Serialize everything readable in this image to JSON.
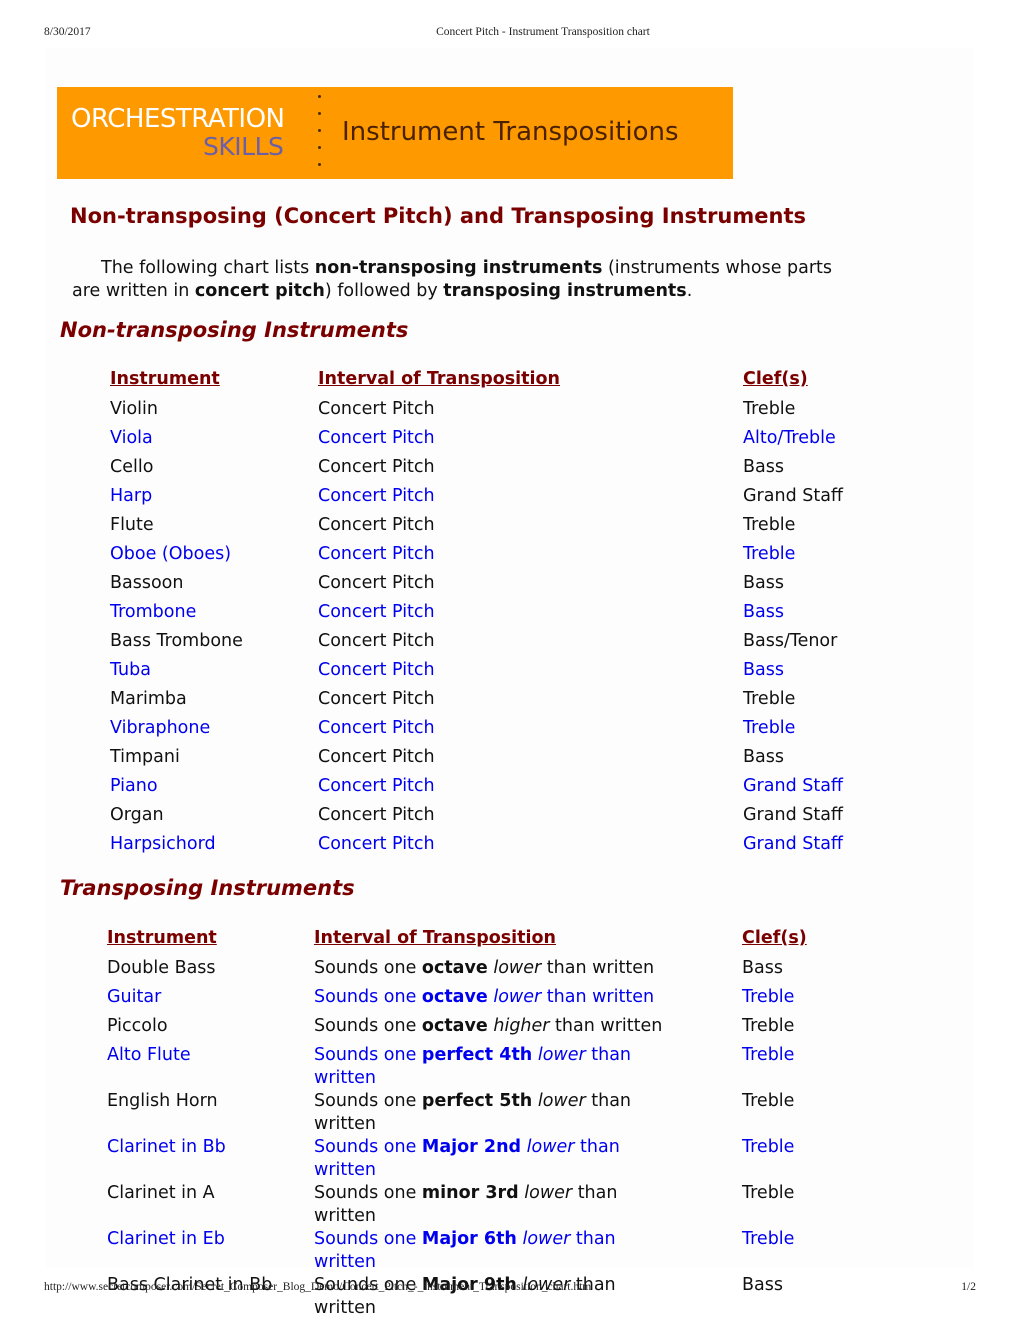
{
  "print_header": {
    "date": "8/30/2017",
    "title": "Concert Pitch - Instrument Transposition chart"
  },
  "print_footer": {
    "url": "http://www.secretcomposer.com/Secret_Composer_Blog_Demo/Concert_Pitch_-_Instrument_Transposition_chart.htm",
    "page": "1/2"
  },
  "banner": {
    "brand_line1": "ORCHESTRATION",
    "brand_line2": "SKILLS",
    "subtitle": "Instrument Transpositions",
    "background_color": "#ff9900"
  },
  "page_title": "Non-transposing (Concert Pitch) and Transposing Instruments",
  "intro": {
    "t1": "The following chart lists ",
    "b1": "non-transposing instruments",
    "t2": " (instruments whose parts are written in ",
    "b2": "concert pitch",
    "t3": ") followed by ",
    "b3": "transposing instruments",
    "t4": "."
  },
  "colors": {
    "heading": "#7a0000",
    "link_blue": "#0000ee",
    "text": "#111111"
  },
  "non_transposing": {
    "heading": "Non-transposing Instruments",
    "columns": [
      "Instrument",
      "Interval of Transposition",
      "Clef(s)"
    ],
    "rows": [
      {
        "instrument": "Violin",
        "interval": "Concert Pitch",
        "clef": "Treble",
        "inst_color": "black",
        "int_color": "black",
        "clef_color": "black"
      },
      {
        "instrument": "Viola",
        "interval": "Concert Pitch",
        "clef": "Alto/Treble",
        "inst_color": "blue",
        "int_color": "blue",
        "clef_color": "blue"
      },
      {
        "instrument": "Cello",
        "interval": "Concert Pitch",
        "clef": "Bass",
        "inst_color": "black",
        "int_color": "black",
        "clef_color": "black"
      },
      {
        "instrument": "Harp",
        "interval": "Concert Pitch",
        "clef": "Grand Staff",
        "inst_color": "blue",
        "int_color": "blue",
        "clef_color": "black"
      },
      {
        "instrument": "Flute",
        "interval": "Concert Pitch",
        "clef": "Treble",
        "inst_color": "black",
        "int_color": "black",
        "clef_color": "black"
      },
      {
        "instrument": "Oboe (Oboes)",
        "interval": "Concert Pitch",
        "clef": "Treble",
        "inst_color": "blue",
        "int_color": "blue",
        "clef_color": "blue"
      },
      {
        "instrument": "Bassoon",
        "interval": "Concert Pitch",
        "clef": "Bass",
        "inst_color": "black",
        "int_color": "black",
        "clef_color": "black"
      },
      {
        "instrument": "Trombone",
        "interval": "Concert Pitch",
        "clef": "Bass",
        "inst_color": "blue",
        "int_color": "blue",
        "clef_color": "blue"
      },
      {
        "instrument": "Bass Trombone",
        "interval": "Concert Pitch",
        "clef": "Bass/Tenor",
        "inst_color": "black",
        "int_color": "black",
        "clef_color": "black"
      },
      {
        "instrument": "Tuba",
        "interval": "Concert Pitch",
        "clef": "Bass",
        "inst_color": "blue",
        "int_color": "blue",
        "clef_color": "blue"
      },
      {
        "instrument": "Marimba",
        "interval": "Concert Pitch",
        "clef": "Treble",
        "inst_color": "black",
        "int_color": "black",
        "clef_color": "black"
      },
      {
        "instrument": "Vibraphone",
        "interval": "Concert Pitch",
        "clef": "Treble",
        "inst_color": "blue",
        "int_color": "blue",
        "clef_color": "blue"
      },
      {
        "instrument": "Timpani",
        "interval": "Concert Pitch",
        "clef": "Bass",
        "inst_color": "black",
        "int_color": "black",
        "clef_color": "black"
      },
      {
        "instrument": "Piano",
        "interval": "Concert Pitch",
        "clef": "Grand Staff",
        "inst_color": "blue",
        "int_color": "blue",
        "clef_color": "blue"
      },
      {
        "instrument": "Organ",
        "interval": "Concert Pitch",
        "clef": "Grand Staff",
        "inst_color": "black",
        "int_color": "black",
        "clef_color": "black"
      },
      {
        "instrument": "Harpsichord",
        "interval": "Concert Pitch",
        "clef": "Grand Staff",
        "inst_color": "blue",
        "int_color": "blue",
        "clef_color": "blue"
      }
    ]
  },
  "transposing": {
    "heading": "Transposing Instruments",
    "columns": [
      "Instrument",
      "Interval of Transposition",
      "Clef(s)"
    ],
    "rows": [
      {
        "instrument": "Double Bass",
        "pre": "Sounds one ",
        "interval_bold": "octave",
        "direction": "lower",
        "post": " than written",
        "clef": "Bass",
        "color": "black"
      },
      {
        "instrument": "Guitar",
        "pre": "Sounds one ",
        "interval_bold": "octave",
        "direction": "lower",
        "post": " than written",
        "clef": "Treble",
        "color": "blue"
      },
      {
        "instrument": "Piccolo",
        "pre": "Sounds one ",
        "interval_bold": "octave",
        "direction": "higher",
        "post": " than written",
        "clef": "Treble",
        "color": "black"
      },
      {
        "instrument": "Alto Flute",
        "pre": "Sounds one ",
        "interval_bold": "perfect 4th",
        "direction": "lower",
        "post": " than written",
        "clef": "Treble",
        "color": "blue"
      },
      {
        "instrument": "English Horn",
        "pre": "Sounds one ",
        "interval_bold": "perfect 5th",
        "direction": "lower",
        "post": " than written",
        "clef": "Treble",
        "color": "black"
      },
      {
        "instrument": "Clarinet in Bb",
        "pre": "Sounds one ",
        "interval_bold": "Major 2nd",
        "direction": "lower",
        "post": " than written",
        "clef": "Treble",
        "color": "blue"
      },
      {
        "instrument": "Clarinet in A",
        "pre": "Sounds one ",
        "interval_bold": "minor 3rd",
        "direction": "lower",
        "post": " than written",
        "clef": "Treble",
        "color": "black"
      },
      {
        "instrument": "Clarinet in Eb",
        "pre": "Sounds one ",
        "interval_bold": "Major 6th",
        "direction": "lower",
        "post": " than written",
        "clef": "Treble",
        "color": "blue"
      },
      {
        "instrument": "Bass Clarinet in Bb",
        "pre": "Sounds one ",
        "interval_bold": "Major 9th",
        "direction": "lower",
        "post": " than written",
        "clef": "Bass",
        "color": "black"
      }
    ]
  }
}
